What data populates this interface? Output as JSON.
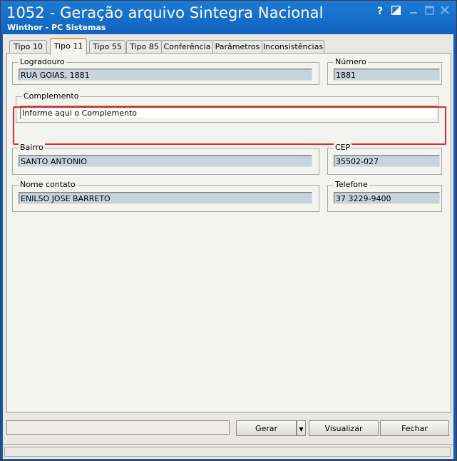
{
  "window": {
    "title": "1052 - Geração arquivo Sintegra Nacional",
    "subtitle": "Winthor - PC Sistemas",
    "controls": {
      "help": "?",
      "restore": "◪",
      "minimize": "▬",
      "maximize": "☐",
      "close": "✕"
    }
  },
  "tabs": [
    {
      "label": "Tipo 10",
      "active": false
    },
    {
      "label": "Tipo 11",
      "active": true
    },
    {
      "label": "Tipo 55",
      "active": false
    },
    {
      "label": "Tipo 85",
      "active": false
    },
    {
      "label": "Conferência",
      "active": false
    },
    {
      "label": "Parâmetros",
      "active": false
    },
    {
      "label": "Inconsistências",
      "active": false
    }
  ],
  "form": {
    "logradouro": {
      "label": "Logradouro",
      "value": "RUA GOIAS, 1881"
    },
    "numero": {
      "label": "Número",
      "value": "1881"
    },
    "complemento": {
      "label": "Complemento",
      "value": "Informe aqui o Complemento"
    },
    "bairro": {
      "label": "Bairro",
      "value": "SANTO ANTONIO"
    },
    "cep": {
      "label": "CEP",
      "value": "35502-027"
    },
    "nome_contato": {
      "label": "Nome contato",
      "value": "ENILSO JOSE BARRETO"
    },
    "telefone": {
      "label": "Telefone",
      "value": "37 3229-9400"
    }
  },
  "buttons": {
    "gerar": "Gerar",
    "visualizar": "Visualizar",
    "fechar": "Fechar"
  },
  "colors": {
    "title_blue": "#0e5cb8",
    "readonly_field": "#c7d3dd",
    "highlight_red": "#e3262b",
    "active_tab_accent": "#e1a73a"
  }
}
